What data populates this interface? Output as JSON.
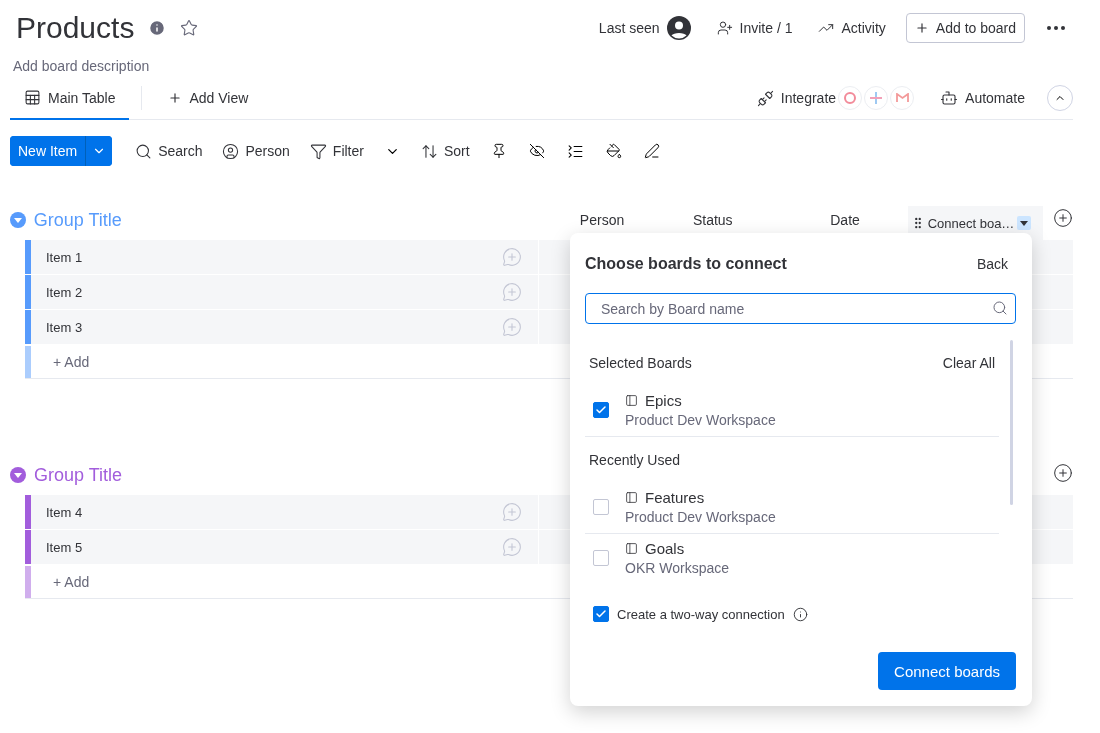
{
  "header": {
    "title": "Products",
    "description": "Add board description",
    "last_seen": "Last seen",
    "invite": "Invite / 1",
    "activity": "Activity",
    "add_to_board": "Add to board"
  },
  "views": {
    "tabs": [
      {
        "label": "Main Table",
        "selected": true
      }
    ],
    "add_view": "Add View",
    "integrate": "Integrate",
    "automate": "Automate"
  },
  "toolbar": {
    "new_item": "New Item",
    "tools": [
      {
        "kind": "search",
        "label": "Search"
      },
      {
        "kind": "person",
        "label": "Person"
      },
      {
        "kind": "filter",
        "label": "Filter"
      },
      {
        "kind": "sort",
        "label": "Sort"
      }
    ]
  },
  "groups": [
    {
      "title": "Group Title",
      "color": "#579bfc",
      "columns": [
        "Person",
        "Status",
        "Date",
        "Connect boa…"
      ],
      "items": [
        "Item 1",
        "Item 2",
        "Item 3"
      ],
      "add_label": "+ Add"
    },
    {
      "title": "Group Title",
      "color": "#a25ddc",
      "items": [
        "Item 4",
        "Item 5"
      ],
      "add_label": "+ Add"
    }
  ],
  "popup": {
    "title": "Choose boards to connect",
    "back": "Back",
    "search_placeholder": "Search by Board name",
    "sections": [
      {
        "heading": "Selected Boards",
        "action": "Clear All",
        "boards": [
          {
            "name": "Epics",
            "workspace": "Product Dev Workspace",
            "checked": true
          }
        ]
      },
      {
        "heading": "Recently Used",
        "boards": [
          {
            "name": "Features",
            "workspace": "Product Dev Workspace",
            "checked": false
          },
          {
            "name": "Goals",
            "workspace": "OKR Workspace",
            "checked": false
          }
        ]
      }
    ],
    "two_way": {
      "label": "Create a two-way connection",
      "checked": true
    },
    "button": "Connect boards"
  }
}
